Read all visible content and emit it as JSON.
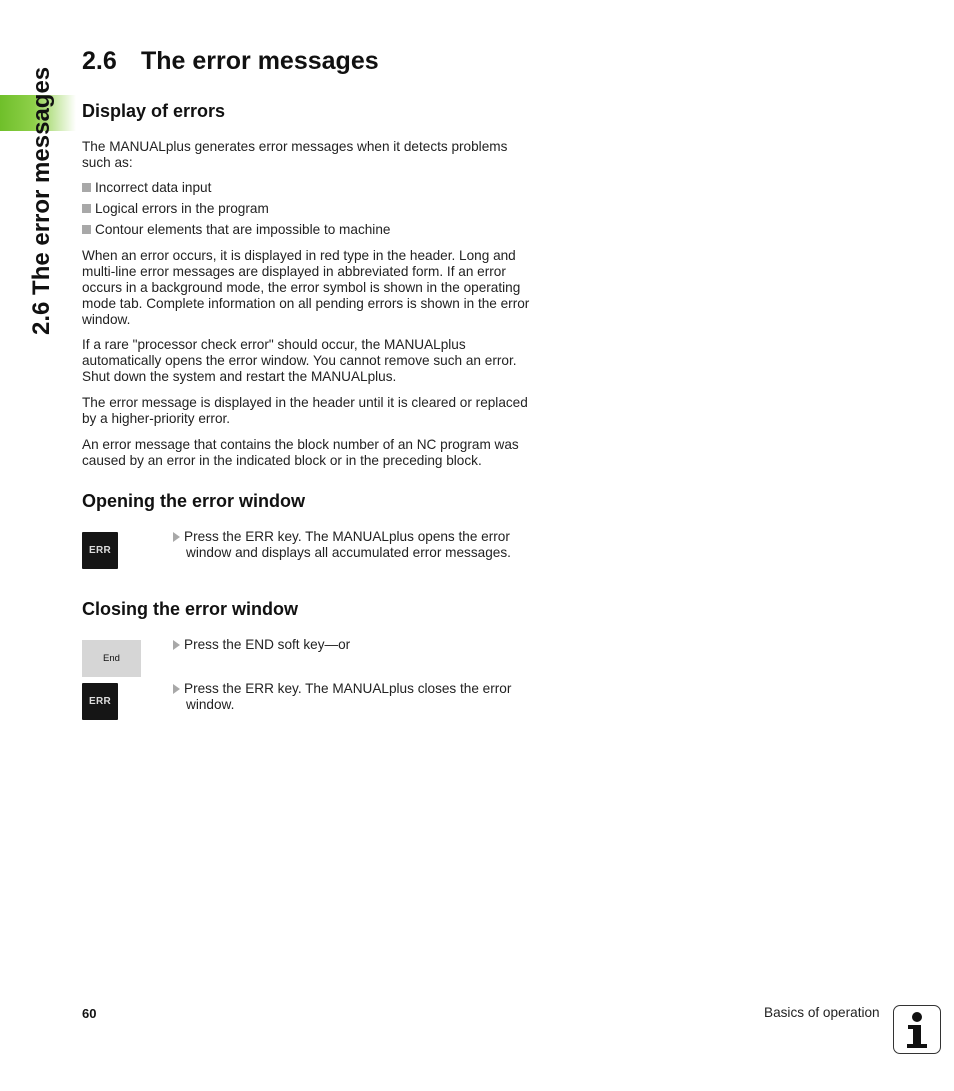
{
  "side_tab": {
    "title": "2.6 The error messages",
    "accent_color": "#7ec63a"
  },
  "header": {
    "section_number": "2.6",
    "title": "The error messages"
  },
  "display": {
    "heading": "Display of errors",
    "intro": "The MANUALplus generates error messages when it detects problems such as:",
    "bullets": [
      "Incorrect data input",
      "Logical errors in the program",
      "Contour elements that are impossible to machine"
    ],
    "paragraphs": [
      "When an error occurs, it is displayed in red type in the header. Long and multi-line error messages are displayed in abbreviated form. If an error occurs in a background mode, the error symbol is shown in the operating mode tab. Complete information on all pending errors is shown in the error window.",
      "If a rare \"processor check error\" should occur, the MANUALplus automatically opens the error window. You cannot remove such an error. Shut down the system and restart the MANUALplus.",
      "The error message is displayed in the header until it is cleared or replaced by a higher-priority error.",
      "An error message that contains the block number of an NC program was caused by an error in the indicated block or in the preceding block."
    ]
  },
  "opening": {
    "heading": "Opening the error window",
    "key_label": "ERR",
    "step_first": "Press the ERR key. The MANUALplus opens the error",
    "step_rest": "window and displays all accumulated error messages."
  },
  "closing": {
    "heading": "Closing the error window",
    "softkey_label": "End",
    "step1": "Press the END soft key—or",
    "key_label": "ERR",
    "step2_first": "Press the ERR key. The MANUALplus closes the error",
    "step2_rest": "window."
  },
  "footer": {
    "page_number": "60",
    "section": "Basics of operation",
    "icon": "info-icon"
  }
}
